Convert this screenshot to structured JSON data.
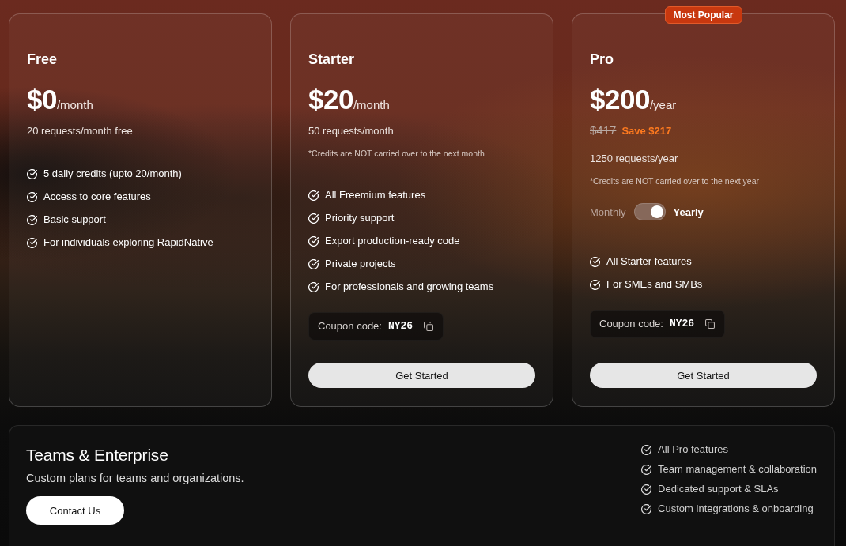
{
  "plans": [
    {
      "name": "Free",
      "price": "$0",
      "period": "/month",
      "description": "20 requests/month free",
      "features": [
        "5 daily credits (upto 20/month)",
        "Access to core features",
        "Basic support",
        "For individuals exploring RapidNative"
      ]
    },
    {
      "name": "Starter",
      "price": "$20",
      "period": "/month",
      "description": "50 requests/month",
      "note": "*Credits are NOT carried over to the next month",
      "features": [
        "All Freemium features",
        "Priority support",
        "Export production-ready code",
        "Private projects",
        "For professionals and growing teams"
      ],
      "coupon": {
        "label": "Coupon code:",
        "code": "NY26"
      },
      "button": "Get Started"
    },
    {
      "name": "Pro",
      "badge": "Most Popular",
      "price": "$200",
      "period": "/year",
      "original_price": "$417",
      "savings": "Save $217",
      "description": "1250 requests/year",
      "note": "*Credits are NOT carried over to the next year",
      "billing_toggle": {
        "left_label": "Monthly",
        "right_label": "Yearly",
        "on": true
      },
      "features": [
        "All Starter features",
        "For SMEs and SMBs"
      ],
      "coupon": {
        "label": "Coupon code:",
        "code": "NY26"
      },
      "button": "Get Started"
    }
  ],
  "enterprise": {
    "title": "Teams & Enterprise",
    "subtitle": "Custom plans for teams and organizations.",
    "button": "Contact Us",
    "features": [
      "All Pro features",
      "Team management & collaboration",
      "Dedicated support & SLAs",
      "Custom integrations & onboarding"
    ]
  }
}
